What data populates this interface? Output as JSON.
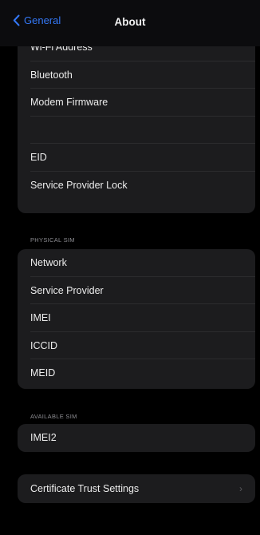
{
  "nav": {
    "back_label": "General",
    "title": "About"
  },
  "group1": {
    "rows": [
      "Wi-Fi Address",
      "Bluetooth",
      "Modem Firmware",
      "",
      "EID",
      "Service Provider Lock"
    ]
  },
  "physical_sim": {
    "header": "PHYSICAL SIM",
    "rows": [
      "Network",
      "Service Provider",
      "IMEI",
      "ICCID",
      "MEID"
    ]
  },
  "available_sim": {
    "header": "AVAILABLE SIM",
    "rows": [
      "IMEI2"
    ]
  },
  "certificate": {
    "label": "Certificate Trust Settings",
    "chevron": "›"
  },
  "colors": {
    "accent": "#3478f6",
    "background": "#000000",
    "cell": "#1c1c1e"
  }
}
